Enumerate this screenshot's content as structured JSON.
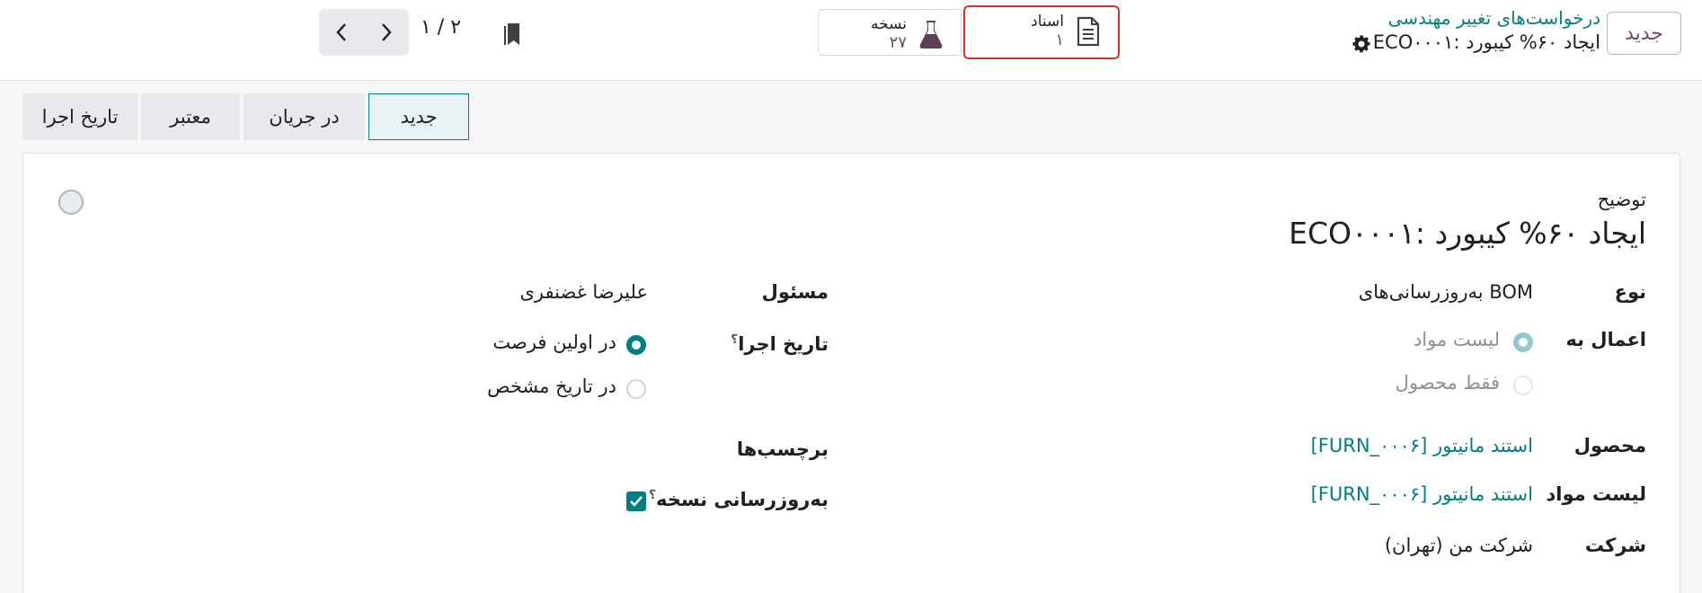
{
  "header": {
    "new_button": "جدید",
    "breadcrumb_parent": "درخواست‌های تغییر مهندسی",
    "breadcrumb_record": "ECO۰۰۰۱: ایجاد ۶۰% کیبورد"
  },
  "stats": {
    "documents": {
      "label": "اسناد",
      "value": "۱"
    },
    "version": {
      "label": "نسخه",
      "value": "۲۷"
    }
  },
  "pager": {
    "value": "۱ / ۲"
  },
  "stages": [
    "جدید",
    "در جریان",
    "معتبر",
    "تاریخ اجرا"
  ],
  "form": {
    "description_label": "توضیح",
    "description_value": "ECO۰۰۰۱: ایجاد ۶۰% کیبورد",
    "type_label": "نوع",
    "type_value": "به‌روزرسانی‌های BOM",
    "apply_on_label": "اعمال به",
    "apply_on_options": [
      "لیست مواد",
      "فقط محصول"
    ],
    "product_label": "محصول",
    "product_value": "[FURN_۰۰۰۶] استند مانیتور",
    "bom_label": "لیست مواد",
    "bom_value": "[FURN_۰۰۰۶] استند مانیتور",
    "company_label": "شرکت",
    "company_value": "شرکت من (تهران)",
    "responsible_label": "مسئول",
    "responsible_value": "علیرضا غضنفری",
    "effective_label": "تاریخ اجرا",
    "effective_options": [
      "در اولین فرصت",
      "در تاریخ مشخص"
    ],
    "tags_label": "برچسب‌ها",
    "version_update_label": "به‌روزرسانی نسخه",
    "help_mark": "؟"
  },
  "colors": {
    "brand": "#714b67",
    "accent": "#017e84",
    "highlight": "#e02e2e"
  }
}
